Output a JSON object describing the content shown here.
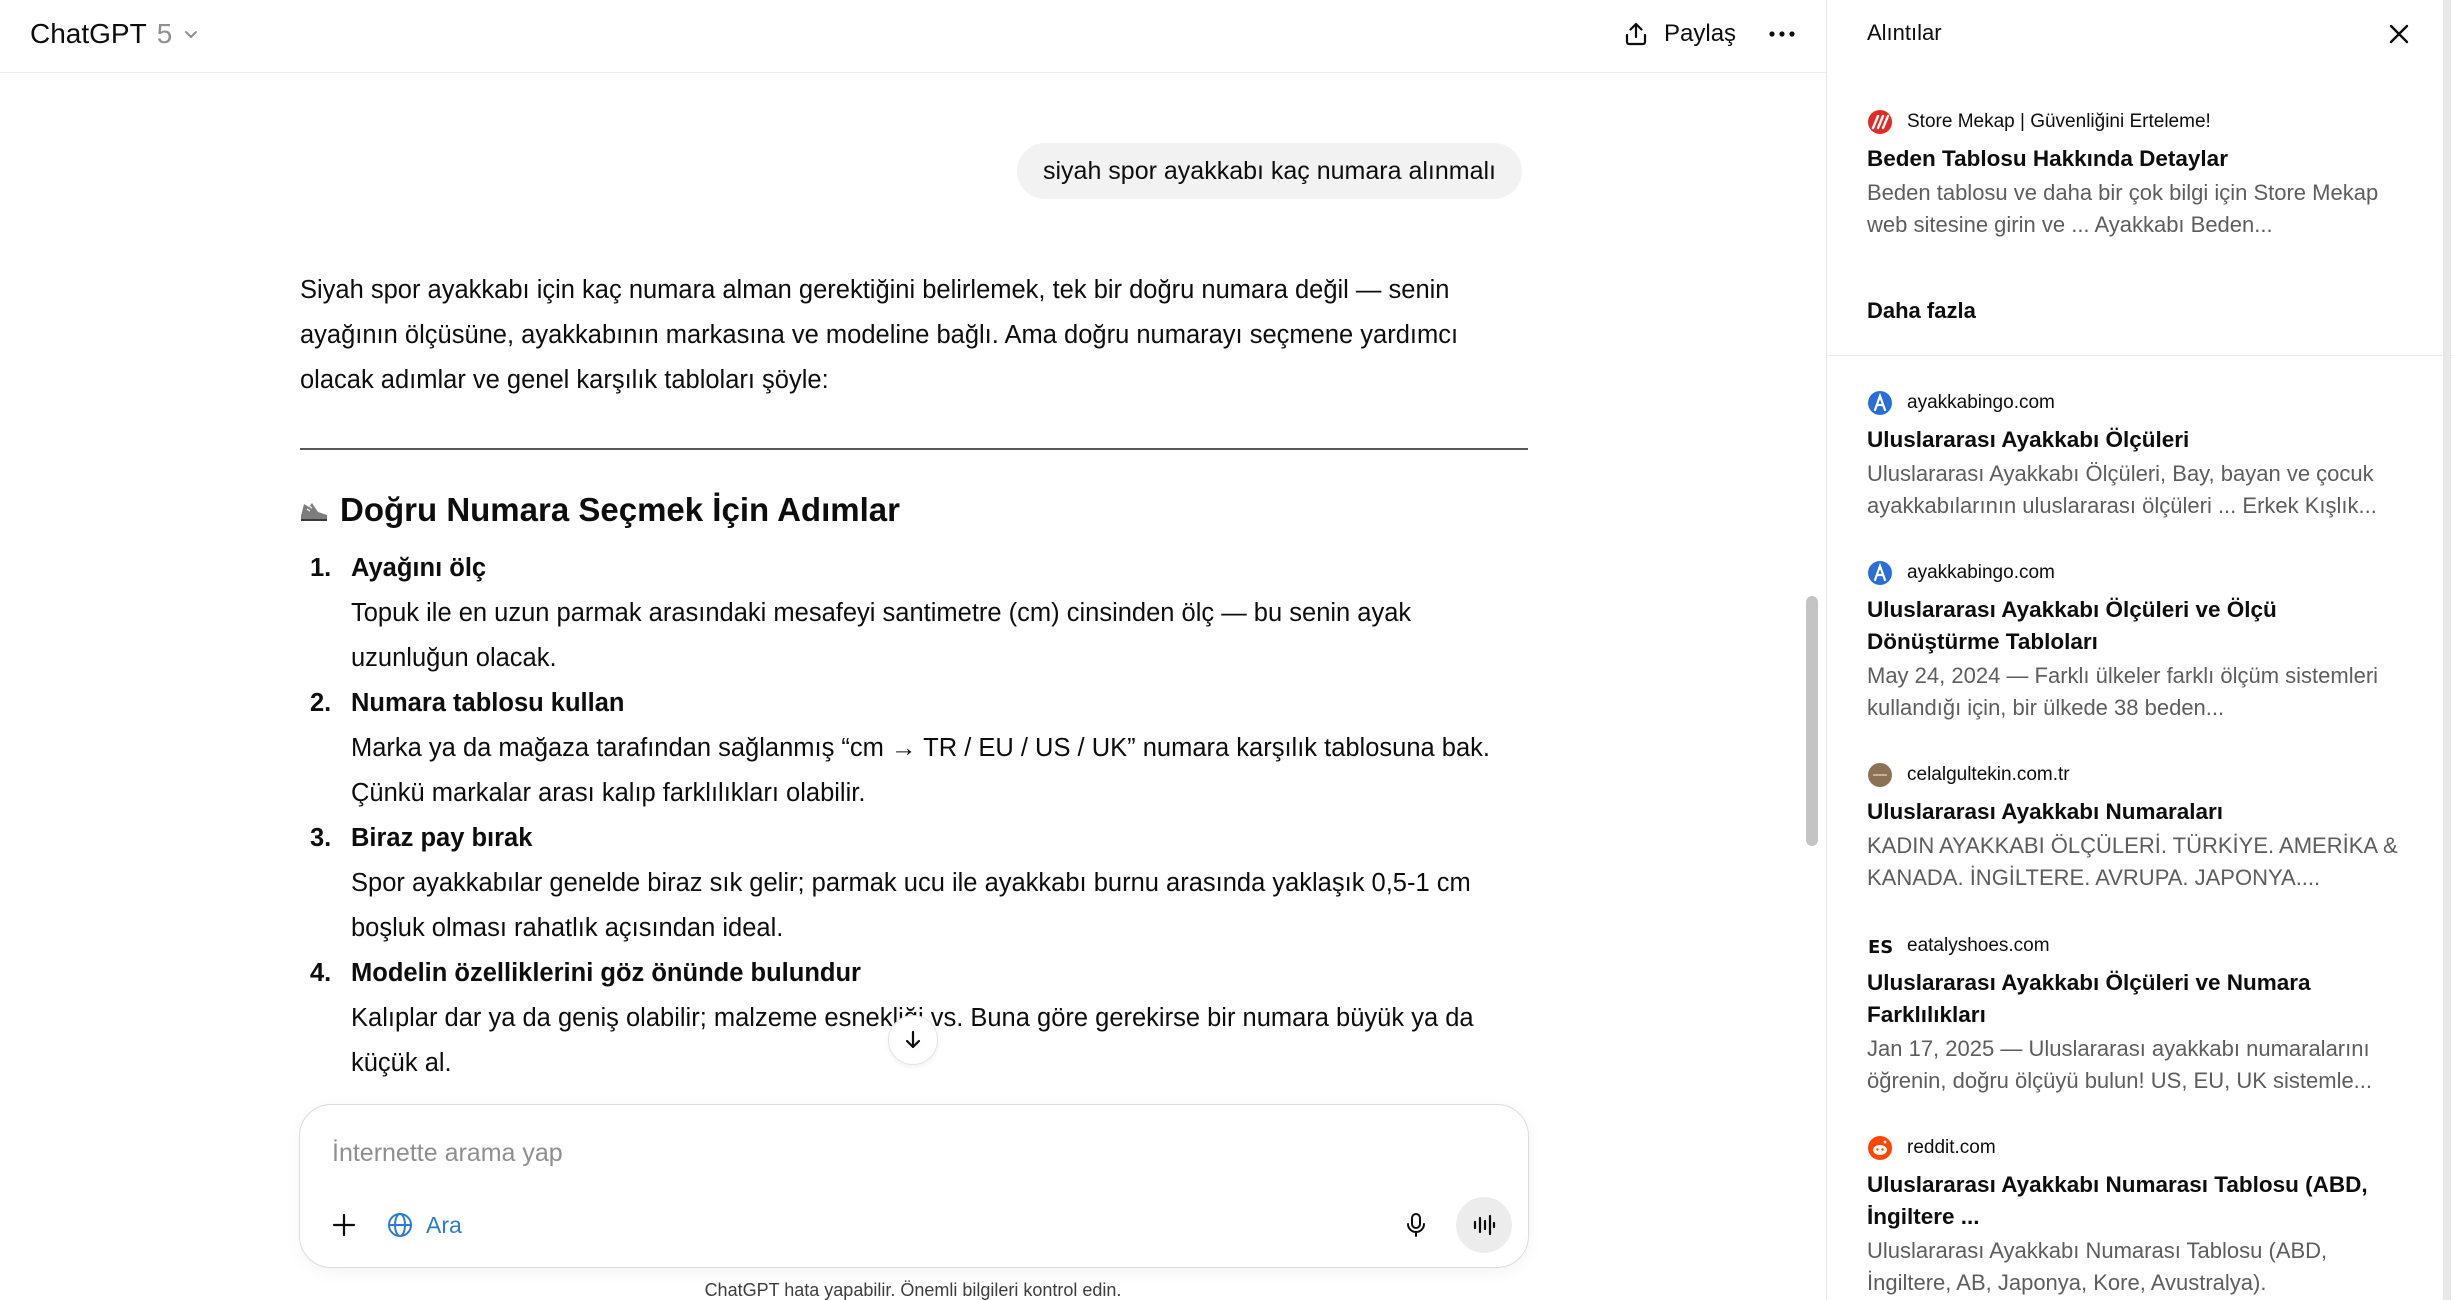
{
  "header": {
    "model_name": "ChatGPT",
    "model_version": "5",
    "share_label": "Paylaş"
  },
  "conversation": {
    "user_message": "siyah spor ayakkabı kaç numara alınmalı",
    "answer_intro": "Siyah spor ayakkabı için kaç numara alman gerektiğini belirlemek, tek bir doğru numara değil — senin ayağının ölçüsüne, ayakkabının markasına ve modeline bağlı. Ama doğru numarayı seçmene yardımcı olacak adımlar ve genel karşılık tabloları şöyle:",
    "section_title": "Doğru Numara Seçmek İçin Adımlar",
    "steps": [
      {
        "num": "1.",
        "title": "Ayağını ölç",
        "text": "Topuk ile en uzun parmak arasındaki mesafeyi santimetre (cm) cinsinden ölç — bu senin ayak uzunluğun olacak."
      },
      {
        "num": "2.",
        "title": "Numara tablosu kullan",
        "text": "Marka ya da mağaza tarafından sağlanmış “cm → TR / EU / US / UK” numara karşılık tablosuna bak. Çünkü markalar arası kalıp farklılıkları olabilir."
      },
      {
        "num": "3.",
        "title": "Biraz pay bırak",
        "text": "Spor ayakkabılar genelde biraz sık gelir; parmak ucu ile ayakkabı burnu arasında yaklaşık 0,5-1 cm boşluk olması rahatlık açısından ideal."
      },
      {
        "num": "4.",
        "title": "Modelin özelliklerini göz önünde bulundur",
        "text": "Kalıplar dar ya da geniş olabilir; malzeme esnekliği vs. Buna göre gerekirse bir numara büyük ya da küçük al."
      }
    ]
  },
  "composer": {
    "placeholder": "İnternette arama yap",
    "search_label": "Ara",
    "accent_color": "#2b7bd8"
  },
  "disclaimer": "ChatGPT hata yapabilir. Önemli bilgileri kontrol edin.",
  "citations_panel": {
    "title": "Alıntılar",
    "more_heading": "Daha fazla",
    "featured": {
      "source": "Store Mekap | Güvenliğini Erteleme!",
      "title": "Beden Tablosu Hakkında Detaylar",
      "snippet": "Beden tablosu ve daha bir çok bilgi için Store Mekap web sitesine girin ve ... Ayakkabı Beden..."
    },
    "items": [
      {
        "source": "ayakkabingo.com",
        "title": "Uluslararası Ayakkabı Ölçüleri",
        "snippet": "Uluslararası Ayakkabı Ölçüleri, Bay, bayan ve çocuk ayakkabılarının uluslararası ölçüleri ... Erkek Kışlık..."
      },
      {
        "source": "ayakkabingo.com",
        "title": "Uluslararası Ayakkabı Ölçüleri ve Ölçü Dönüştürme Tabloları",
        "snippet": "May 24, 2024 — Farklı ülkeler farklı ölçüm sistemleri kullandığı için, bir ülkede 38 beden..."
      },
      {
        "source": "celalgultekin.com.tr",
        "title": "Uluslararası Ayakkabı Numaraları",
        "snippet": "KADIN AYAKKABI ÖLÇÜLERİ. TÜRKİYE. AMERİKA & KANADA. İNGİLTERE. AVRUPA. JAPONYA...."
      },
      {
        "source": "eatalyshoes.com",
        "title": "Uluslararası Ayakkabı Ölçüleri ve Numara Farklılıkları",
        "snippet": "Jan 17, 2025 — Uluslararası ayakkabı numaralarını öğrenin, doğru ölçüyü bulun! US, EU, UK sistemle..."
      },
      {
        "source": "reddit.com",
        "title": "Uluslararası Ayakkabı Numarası Tablosu (ABD, İngiltere ...",
        "snippet": "Uluslararası Ayakkabı Numarası Tablosu (ABD, İngiltere, AB, Japonya, Kore, Avustralya)."
      }
    ]
  }
}
